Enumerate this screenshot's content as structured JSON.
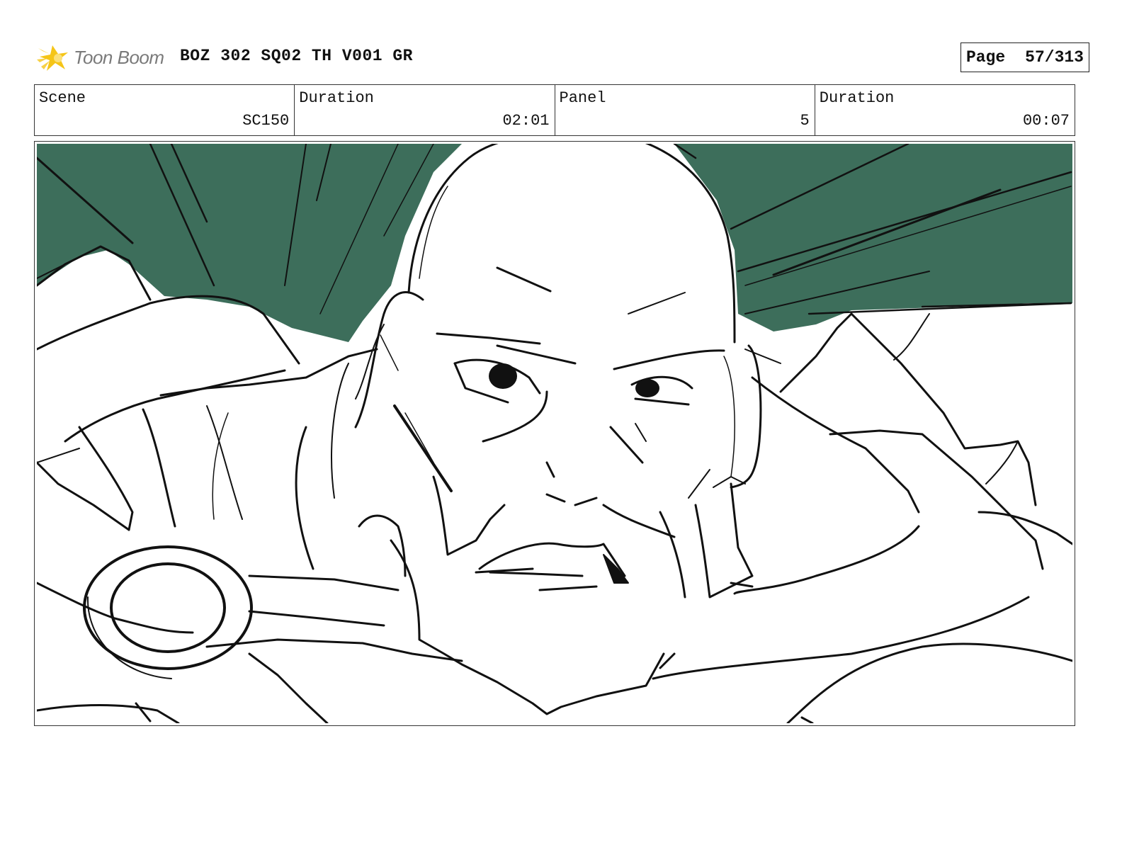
{
  "header": {
    "logo_text": "Toon Boom",
    "doc_title": "BOZ 302 SQ02 TH V001 GR",
    "page_label": "Page",
    "page_value": "57/313"
  },
  "info": {
    "scene_label": "Scene",
    "scene_value": "SC150",
    "scene_duration_label": "Duration",
    "scene_duration_value": "02:01",
    "panel_label": "Panel",
    "panel_value": "5",
    "panel_duration_label": "Duration",
    "panel_duration_value": "00:07"
  },
  "colors": {
    "background_green": "#3d6e5b",
    "line": "#111111",
    "logo_yellow": "#f5c518"
  },
  "icons": {
    "logo": "toon-boom-star-logo-icon"
  }
}
